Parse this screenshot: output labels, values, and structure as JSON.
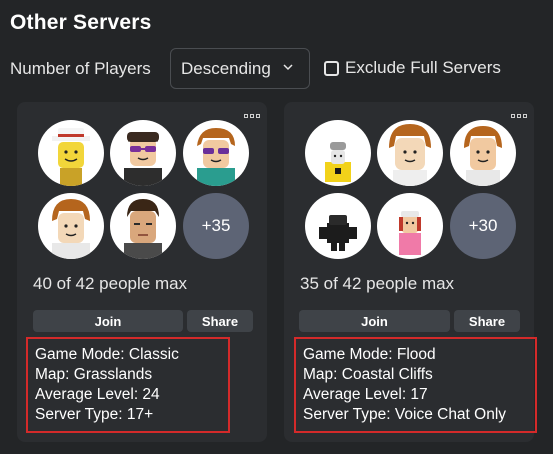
{
  "section": {
    "title": "Other Servers"
  },
  "filters": {
    "number_label": "Number of Players",
    "sort_value": "Descending",
    "exclude_label": "Exclude Full Servers",
    "exclude_checked": false
  },
  "servers": [
    {
      "capacity": "40 of 42 people max",
      "extra_players": "+35",
      "join_label": "Join",
      "share_label": "Share",
      "info": [
        "Game Mode: Classic",
        "Map: Grasslands",
        "Average Level: 24",
        "Server Type: 17+"
      ]
    },
    {
      "capacity": "35 of 42 people max",
      "extra_players": "+30",
      "join_label": "Join",
      "share_label": "Share",
      "info": [
        "Game Mode: Flood",
        "Map: Coastal Cliffs",
        "Average Level: 17",
        "Server Type: Voice Chat Only"
      ]
    }
  ],
  "colors": {
    "background": "#232527",
    "card": "#2b2d30",
    "button": "#3f4348",
    "more_circle": "#5d6475",
    "highlight_border": "#d42a2a"
  }
}
